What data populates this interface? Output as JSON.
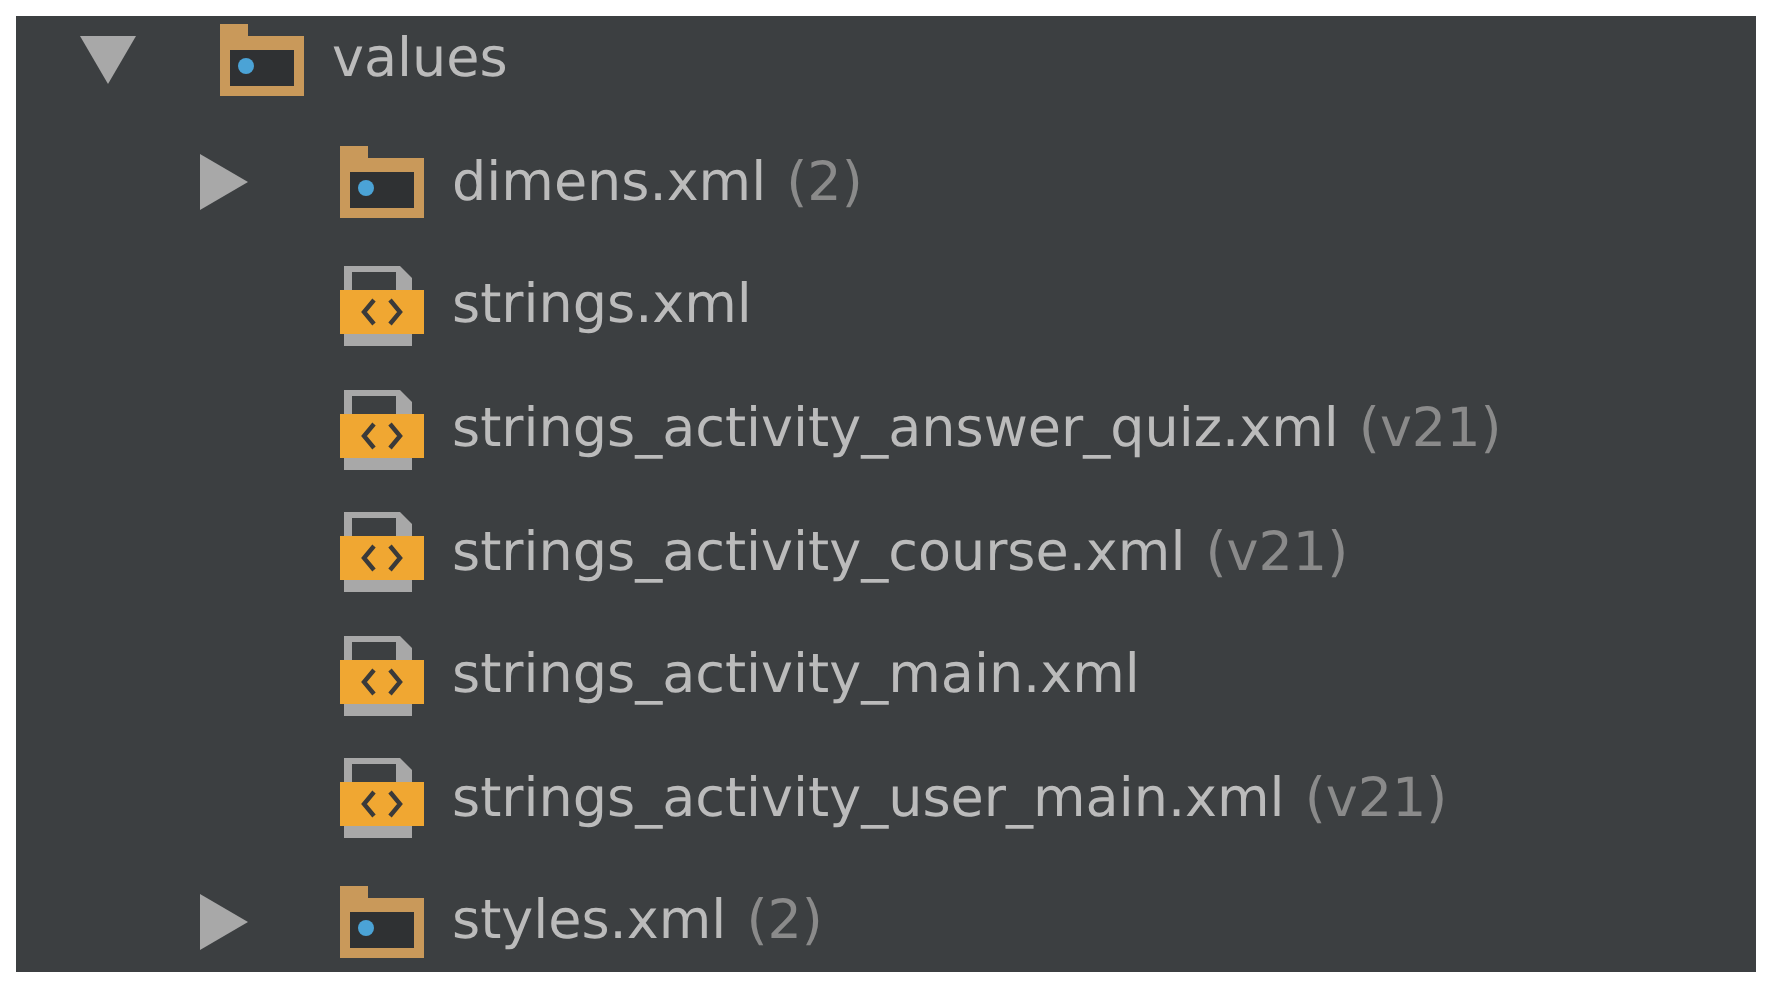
{
  "tree": [
    {
      "kind": "folder",
      "label": "values",
      "expanded": true,
      "children": [
        {
          "kind": "folder",
          "label": "dimens.xml",
          "hint": "(2)",
          "expanded": false
        },
        {
          "kind": "file",
          "label": "strings.xml"
        },
        {
          "kind": "file",
          "label": "strings_activity_answer_quiz.xml",
          "hint": "(v21)"
        },
        {
          "kind": "file",
          "label": "strings_activity_course.xml",
          "hint": "(v21)"
        },
        {
          "kind": "file",
          "label": "strings_activity_main.xml"
        },
        {
          "kind": "file",
          "label": "strings_activity_user_main.xml",
          "hint": "(v21)"
        },
        {
          "kind": "folder",
          "label": "styles.xml",
          "hint": "(2)",
          "expanded": false
        }
      ]
    }
  ]
}
